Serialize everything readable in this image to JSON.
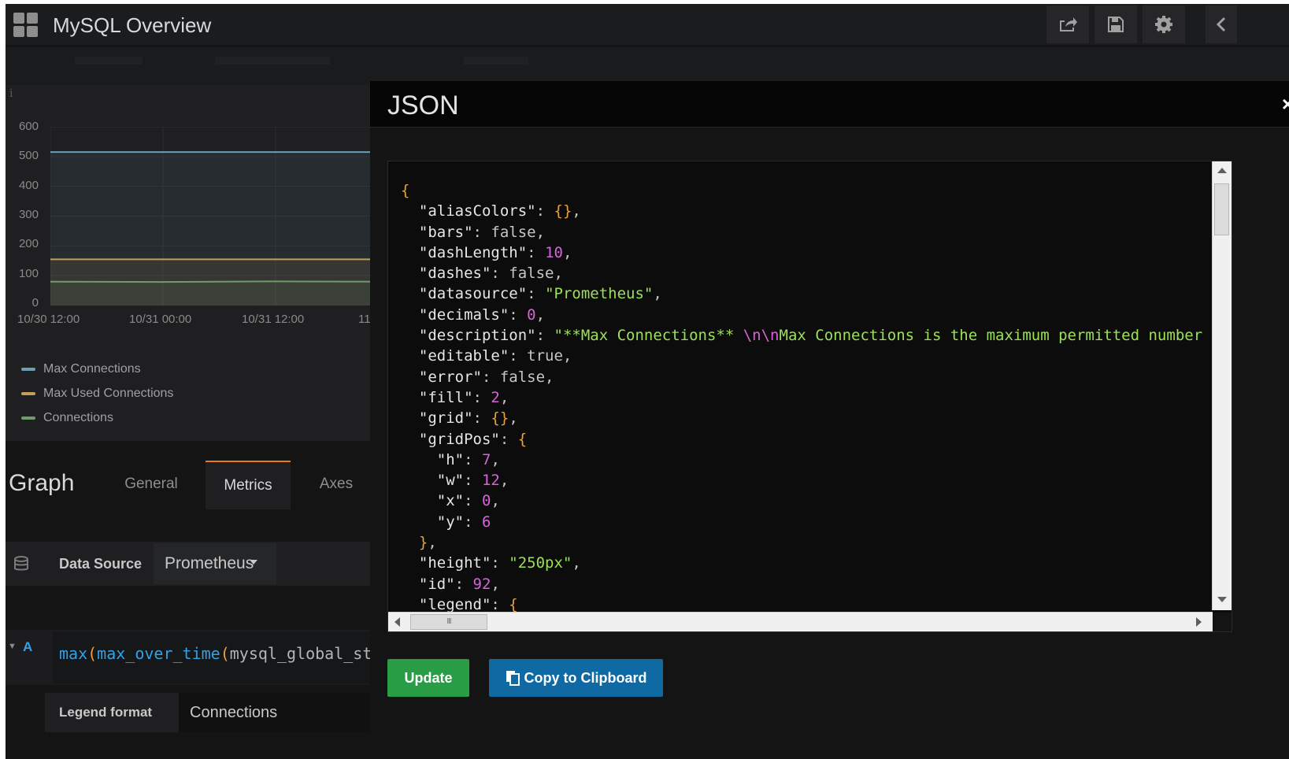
{
  "dashboard": {
    "title": "MySQL Overview",
    "toolbar": [
      "share-icon",
      "save-icon",
      "settings-icon",
      "back-icon"
    ]
  },
  "graph": {
    "y_ticks": [
      "600",
      "500",
      "400",
      "300",
      "200",
      "100",
      "0"
    ],
    "x_ticks": [
      "10/30 12:00",
      "10/31 00:00",
      "10/31 12:00",
      "11"
    ],
    "legend": [
      {
        "label": "Max Connections",
        "color": "#6d9eb8"
      },
      {
        "label": "Max Used Connections",
        "color": "#c0a054"
      },
      {
        "label": "Connections",
        "color": "#6e9c6a"
      }
    ]
  },
  "chart_data": {
    "type": "line",
    "x": [
      "10/30 12:00",
      "10/31 00:00",
      "10/31 12:00",
      "11"
    ],
    "ylim": [
      0,
      600
    ],
    "series": [
      {
        "name": "Max Connections",
        "color": "#6d9eb8",
        "values": [
          515,
          515,
          515,
          515
        ]
      },
      {
        "name": "Max Used Connections",
        "color": "#c0a054",
        "values": [
          155,
          155,
          155,
          155
        ]
      },
      {
        "name": "Connections",
        "color": "#6e9c6a",
        "values": [
          80,
          79,
          81,
          80
        ]
      }
    ]
  },
  "editor": {
    "title": "Graph",
    "tabs": [
      "General",
      "Metrics",
      "Axes"
    ],
    "active_tab": "Metrics",
    "data_source_label": "Data Source",
    "data_source_value": "Prometheus",
    "query_letter": "A",
    "query_fn": "max",
    "query_paren": "(",
    "query_inner": "max_over_time",
    "query_rest": "mysql_global_sta",
    "legend_format_label": "Legend format",
    "legend_format_value": "Connections"
  },
  "modal": {
    "title": "JSON",
    "close": "×",
    "update_label": "Update",
    "copy_label": "Copy to Clipboard",
    "scroll_grip": "III",
    "json_text": "{\n  \"aliasColors\": {},\n  \"bars\": false,\n  \"dashLength\": 10,\n  \"dashes\": false,\n  \"datasource\": \"Prometheus\",\n  \"decimals\": 0,\n  \"description\": \"**Max Connections** \\n\\nMax Connections is the maximum permitted number\n  \"editable\": true,\n  \"error\": false,\n  \"fill\": 2,\n  \"grid\": {},\n  \"gridPos\": {\n    \"h\": 7,\n    \"w\": 12,\n    \"x\": 0,\n    \"y\": 6\n  },\n  \"height\": \"250px\",\n  \"id\": 92,\n  \"legend\": {"
  }
}
